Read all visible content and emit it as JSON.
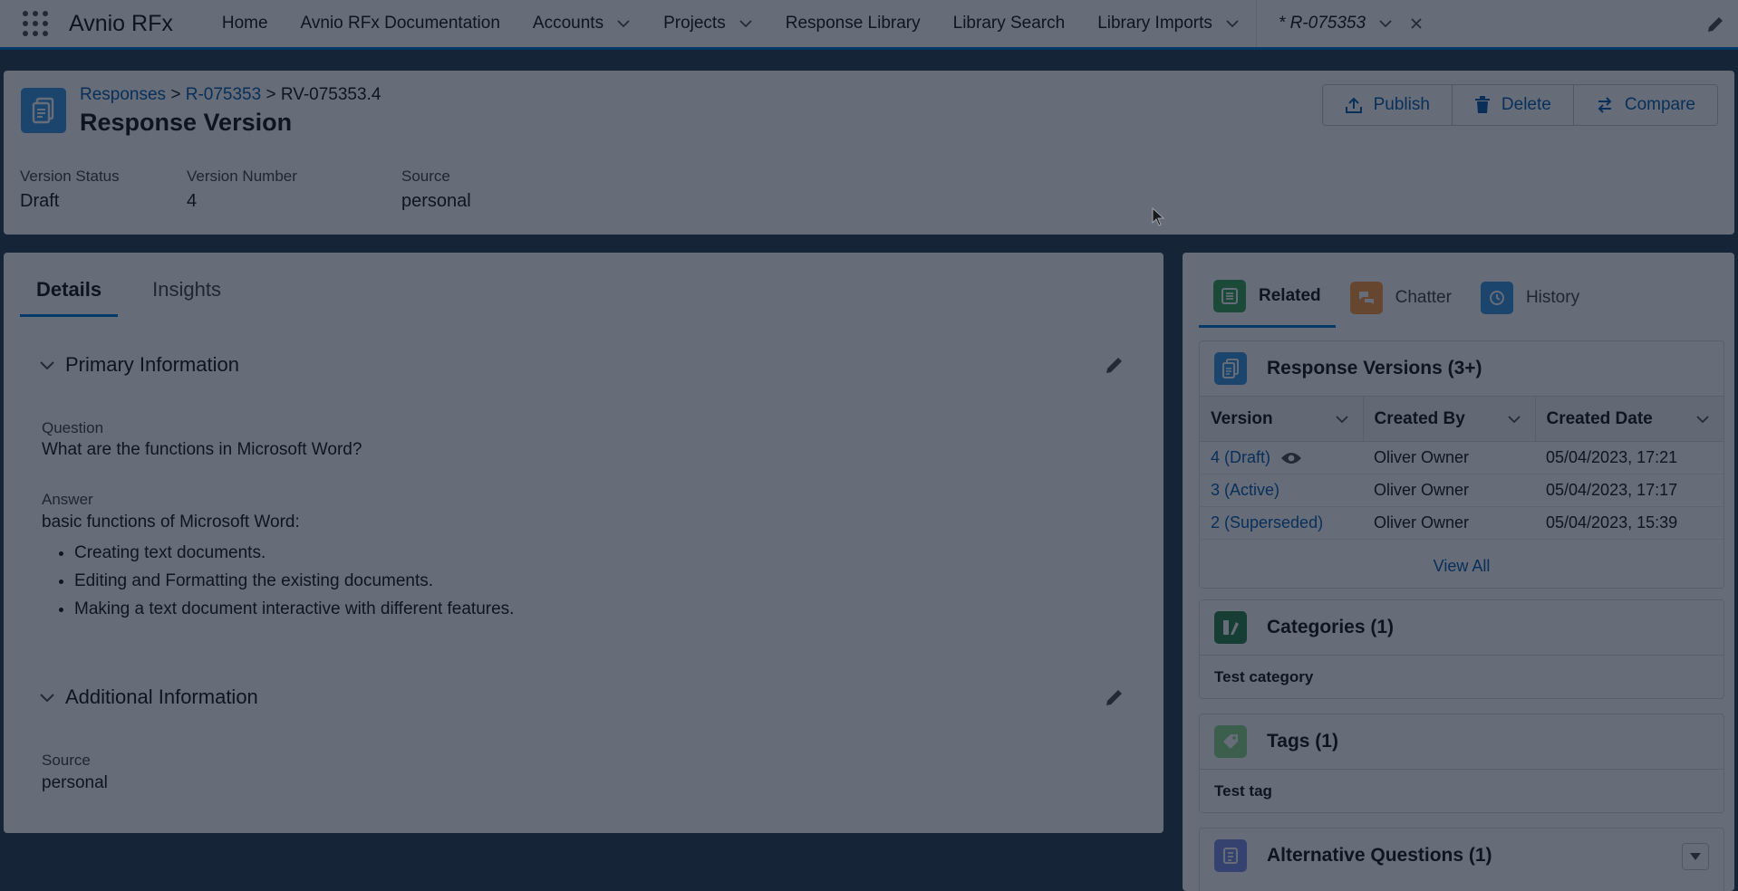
{
  "nav": {
    "app_name": "Avnio RFx",
    "items": [
      {
        "label": "Home",
        "dropdown": false
      },
      {
        "label": "Avnio RFx Documentation",
        "dropdown": false
      },
      {
        "label": "Accounts",
        "dropdown": true
      },
      {
        "label": "Projects",
        "dropdown": true
      },
      {
        "label": "Response Library",
        "dropdown": false
      },
      {
        "label": "Library Search",
        "dropdown": false
      },
      {
        "label": "Library Imports",
        "dropdown": true
      }
    ],
    "active_tab": "* R-075353"
  },
  "header": {
    "breadcrumb": {
      "root": "Responses",
      "sep1": " > ",
      "parent": "R-075353",
      "sep2": " > ",
      "current": "RV-075353.4"
    },
    "title": "Response Version",
    "actions": {
      "publish": "Publish",
      "delete": "Delete",
      "compare": "Compare"
    },
    "fields": [
      {
        "label": "Version Status",
        "value": "Draft"
      },
      {
        "label": "Version Number",
        "value": "4"
      },
      {
        "label": "Source",
        "value": "personal"
      }
    ]
  },
  "details": {
    "tabs": {
      "details": "Details",
      "insights": "Insights"
    },
    "primary": {
      "title": "Primary Information",
      "question_label": "Question",
      "question": "What are the functions in Microsoft Word?",
      "answer_label": "Answer",
      "answer_intro": "basic functions of Microsoft Word:",
      "answer_items": [
        "Creating text documents.",
        "Editing and Formatting the existing documents.",
        "Making a text document interactive with different features."
      ]
    },
    "additional": {
      "title": "Additional Information",
      "source_label": "Source",
      "source": "personal"
    }
  },
  "related": {
    "tabs": {
      "related": "Related",
      "chatter": "Chatter",
      "history": "History"
    },
    "versions": {
      "title": "Response Versions (3+)",
      "columns": [
        "Version",
        "Created By",
        "Created Date"
      ],
      "rows": [
        {
          "version": "4 (Draft)",
          "created_by": "Oliver Owner",
          "created_date": "05/04/2023, 17:21"
        },
        {
          "version": "3 (Active)",
          "created_by": "Oliver Owner",
          "created_date": "05/04/2023, 17:17"
        },
        {
          "version": "2 (Superseded)",
          "created_by": "Oliver Owner",
          "created_date": "05/04/2023, 15:39"
        }
      ],
      "view_all": "View All"
    },
    "categories": {
      "title": "Categories (1)",
      "item": "Test category"
    },
    "tags": {
      "title": "Tags (1)",
      "item": "Test tag"
    },
    "alt_questions": {
      "title": "Alternative Questions (1)"
    }
  },
  "colors": {
    "brand": "#0176d3",
    "link": "#0b5cab",
    "record_icon": "#3c97dd",
    "related_icon": "#3ba755",
    "chatter_icon": "#ff9a3c",
    "history_icon": "#3c97dd",
    "categories_icon": "#2e844a",
    "tags_icon": "#91db8b",
    "alt_questions_icon": "#7f8de1",
    "overlay": "#081426"
  }
}
